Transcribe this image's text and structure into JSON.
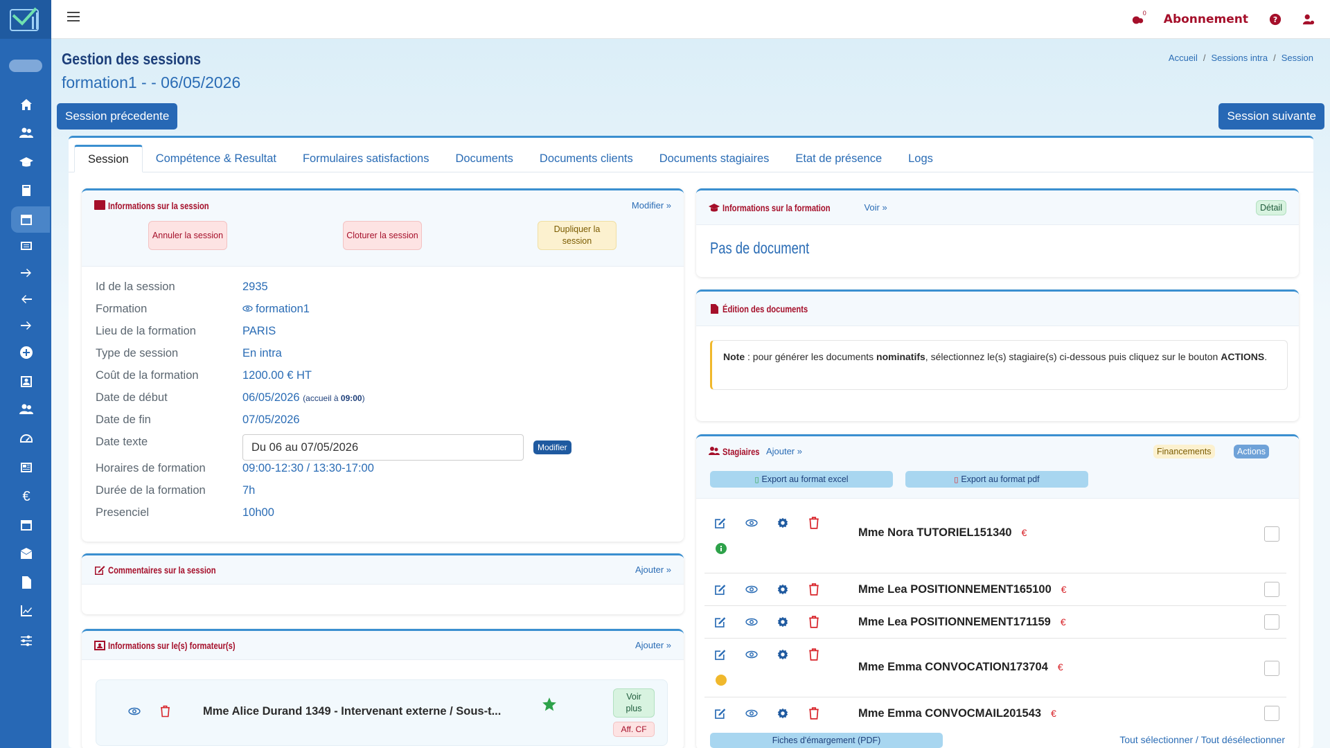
{
  "topbar": {
    "notif_count": "0",
    "abonnement": "Abonnement"
  },
  "page": {
    "title": "Gestion des sessions",
    "subtitle": "formation1 - - 06/05/2026"
  },
  "breadcrumb": {
    "home": "Accueil",
    "sessions": "Sessions intra",
    "current": "Session"
  },
  "nav": {
    "prev": "Session précedente",
    "next": "Session suivante"
  },
  "tabs": [
    "Session",
    "Compétence & Resultat",
    "Formulaires satisfactions",
    "Documents",
    "Documents clients",
    "Documents stagiaires",
    "Etat de présence",
    "Logs"
  ],
  "session_info": {
    "title": "Informations sur la session",
    "modify": "Modifier »",
    "cancel_btn": "Annuler la session",
    "close_btn": "Cloturer la session",
    "dup_btn": "Dupliquer la session",
    "rows": [
      {
        "k": "Id de la session",
        "v": "2935"
      },
      {
        "k": "Formation",
        "v": "formation1"
      },
      {
        "k": "Lieu de la formation",
        "v": "PARIS"
      },
      {
        "k": "Type de session",
        "v": "En intra"
      },
      {
        "k": "Coût de la formation",
        "v": "1200.00 € HT"
      },
      {
        "k": "Date de début",
        "v": "06/05/2026",
        "extra_pre": "(accueil à ",
        "extra_time": "09:00",
        "extra_post": ")"
      },
      {
        "k": "Date de fin",
        "v": "07/05/2026"
      },
      {
        "k": "Date texte",
        "v": "Du 06 au 07/05/2026",
        "btn": "Modifier"
      },
      {
        "k": "Horaires de formation",
        "v": "09:00-12:30 / 13:30-17:00"
      },
      {
        "k": "Durée de la formation",
        "v": "7h"
      },
      {
        "k": "Presenciel",
        "v": "10h00"
      }
    ]
  },
  "comments": {
    "title": "Commentaires sur la session",
    "add": "Ajouter »"
  },
  "trainers": {
    "title": "Informations sur le(s) formateur(s)",
    "add": "Ajouter »",
    "name": "Mme Alice Durand 1349 - Intervenant externe / Sous-t...",
    "voir_plus": "Voir plus",
    "aff": "Aff. CF"
  },
  "formation_info": {
    "title": "Informations sur la formation",
    "voir": "Voir »",
    "detail": "Détail",
    "empty": "Pas de document"
  },
  "edition": {
    "title": "Édition des documents",
    "note_label": "Note",
    "note_a": " : pour générer les documents ",
    "note_bold": "nominatifs",
    "note_b": ", sélectionnez le(s) stagiaire(s) ci-dessous puis cliquez sur le bouton ",
    "note_actions": "ACTIONS",
    "note_end": "."
  },
  "stagiaires": {
    "title": "Stagiaires",
    "add": "Ajouter »",
    "financements": "Financements",
    "actions": "Actions",
    "export_excel": "Export au format excel",
    "export_pdf": "Export au format pdf",
    "items": [
      {
        "name": "Mme Nora TUTORIEL151340",
        "euro": "€",
        "status": "green"
      },
      {
        "name": "Mme Lea POSITIONNEMENT165100",
        "euro": "€"
      },
      {
        "name": "Mme Lea POSITIONNEMENT171159",
        "euro": "€"
      },
      {
        "name": "Mme Emma CONVOCATION173704",
        "euro": "€",
        "status": "yellow"
      },
      {
        "name": "Mme Emma CONVOCMAIL201543",
        "euro": "€"
      }
    ],
    "fiches": "Fiches d'émargement (PDF)",
    "select_all": "Tout sélectionner",
    "sep": "/",
    "deselect_all": "Tout désélectionner"
  },
  "colors": {
    "primary": "#2768b5",
    "accent_red": "#a50f2a",
    "link": "#2a6cb5"
  },
  "sidebar_icons": [
    "home-icon",
    "users-icon",
    "graduation-icon",
    "book-icon",
    "calendar-icon",
    "list-icon",
    "arrow-right-icon",
    "arrow-left-icon",
    "arrow-right-icon",
    "plus-circle-icon",
    "id-card-icon",
    "group-icon",
    "gauge-icon",
    "newspaper-icon",
    "euro-icon",
    "calendar-alt-icon",
    "mail-icon",
    "file-icon",
    "chart-icon",
    "sliders-icon"
  ]
}
